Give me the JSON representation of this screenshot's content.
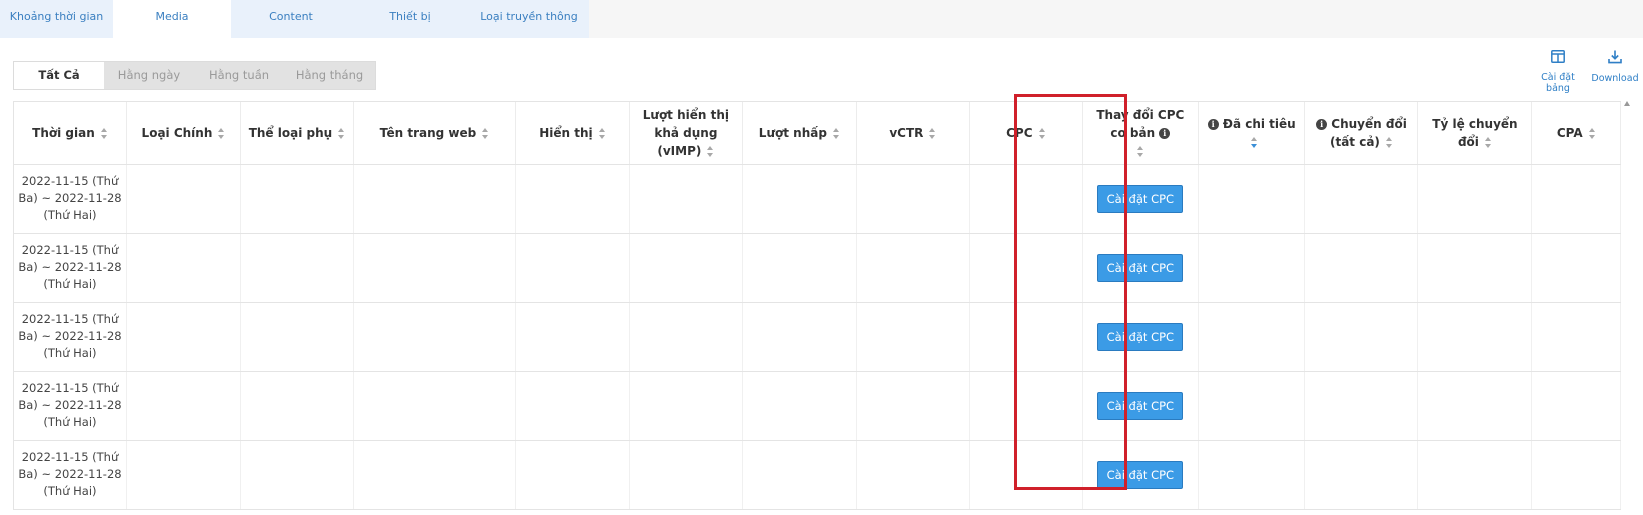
{
  "top_tabs": [
    {
      "label": "Khoảng thời gian",
      "active": false
    },
    {
      "label": "Media",
      "active": true
    },
    {
      "label": "Content",
      "active": false
    },
    {
      "label": "Thiết bị",
      "active": false
    },
    {
      "label": "Loại truyền thông",
      "active": false
    }
  ],
  "period_tabs": [
    {
      "label": "Tất Cả",
      "active": true
    },
    {
      "label": "Hằng ngày",
      "active": false
    },
    {
      "label": "Hằng tuần",
      "active": false
    },
    {
      "label": "Hằng tháng",
      "active": false
    }
  ],
  "tools": {
    "settings_label": "Cài đặt bảng",
    "download_label": "Download"
  },
  "columns": [
    {
      "label": "Thời gian",
      "info": false
    },
    {
      "label": "Loại Chính",
      "info": false
    },
    {
      "label": "Thể loại phụ",
      "info": false
    },
    {
      "label": "Tên trang web",
      "info": false
    },
    {
      "label": "Hiển thị",
      "info": false
    },
    {
      "label": "Lượt hiển thị khả dụng (vIMP)",
      "info": false
    },
    {
      "label": "Lượt nhấp",
      "info": false
    },
    {
      "label": "vCTR",
      "info": false
    },
    {
      "label": "CPC",
      "info": false
    },
    {
      "label": "Thay đổi CPC cơ bản",
      "info": true
    },
    {
      "label": "Đã chi tiêu",
      "info": true
    },
    {
      "label": "Chuyển đổi (tất cả)",
      "info": true
    },
    {
      "label": "Tỷ lệ chuyển đổi",
      "info": false
    },
    {
      "label": "CPA",
      "info": false
    }
  ],
  "rows": [
    {
      "time": "2022-11-15 (Thứ Ba) ~ 2022-11-28 (Thứ Hai)",
      "cpc_button": "Cài đặt CPC"
    },
    {
      "time": "2022-11-15 (Thứ Ba) ~ 2022-11-28 (Thứ Hai)",
      "cpc_button": "Cài đặt CPC"
    },
    {
      "time": "2022-11-15 (Thứ Ba) ~ 2022-11-28 (Thứ Hai)",
      "cpc_button": "Cài đặt CPC"
    },
    {
      "time": "2022-11-15 (Thứ Ba) ~ 2022-11-28 (Thứ Hai)",
      "cpc_button": "Cài đặt CPC"
    },
    {
      "time": "2022-11-15 (Thứ Ba) ~ 2022-11-28 (Thứ Hai)",
      "cpc_button": "Cài đặt CPC"
    }
  ],
  "colors": {
    "accent": "#3b9be6",
    "tab_text": "#3a7fc0",
    "highlight": "#d0202a"
  }
}
